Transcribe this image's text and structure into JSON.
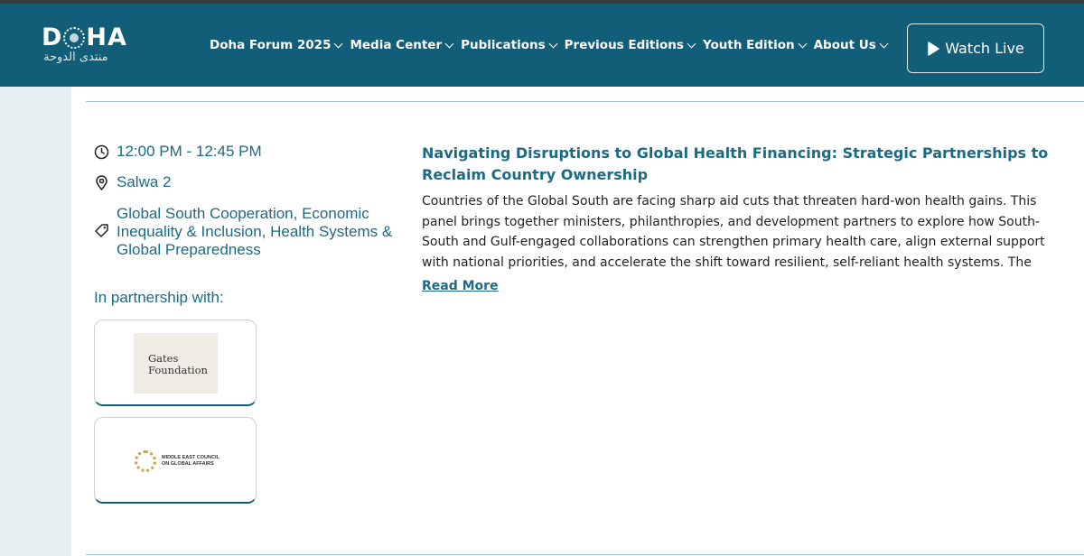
{
  "header": {
    "logo_text_left": "D",
    "logo_text_right": "HA",
    "logo_arabic": "منتدى الدوحة",
    "nav": [
      {
        "label": "Doha Forum 2025"
      },
      {
        "label": "Media Center"
      },
      {
        "label": "Publications"
      },
      {
        "label": "Previous Editions"
      },
      {
        "label": "Youth Edition"
      },
      {
        "label": "About Us"
      }
    ],
    "watch_live_label": "Watch Live"
  },
  "session": {
    "time": "12:00 PM - 12:45 PM",
    "location": "Salwa 2",
    "tags": "Global South Cooperation, Economic Inequality & Inclusion, Health Systems & Global Preparedness",
    "partnership_label": "In partnership with:",
    "partners": [
      {
        "name": "Gates Foundation",
        "line1": "Gates",
        "line2": "Foundation"
      },
      {
        "name": "Middle East Council on Global Affairs",
        "line1": "MIDDLE EAST COUNCIL",
        "line2": "ON GLOBAL AFFAIRS"
      }
    ],
    "title": "Navigating Disruptions to Global Health Financing: Strategic Partnerships to Reclaim Country Ownership",
    "description": "Countries of the Global South are facing sharp aid cuts that threaten hard-won health gains. This panel brings together ministers, philanthropies, and development partners to explore how South-South and Gulf-engaged collaborations can strengthen primary health care, align external support with national priorities, and accelerate the shift toward resilient, self-reliant health systems. The discussion asks: How",
    "read_more": "Read More"
  },
  "colors": {
    "header_bg": "#125d78",
    "accent_text": "#1d6a84",
    "left_band": "#e6eef2"
  }
}
